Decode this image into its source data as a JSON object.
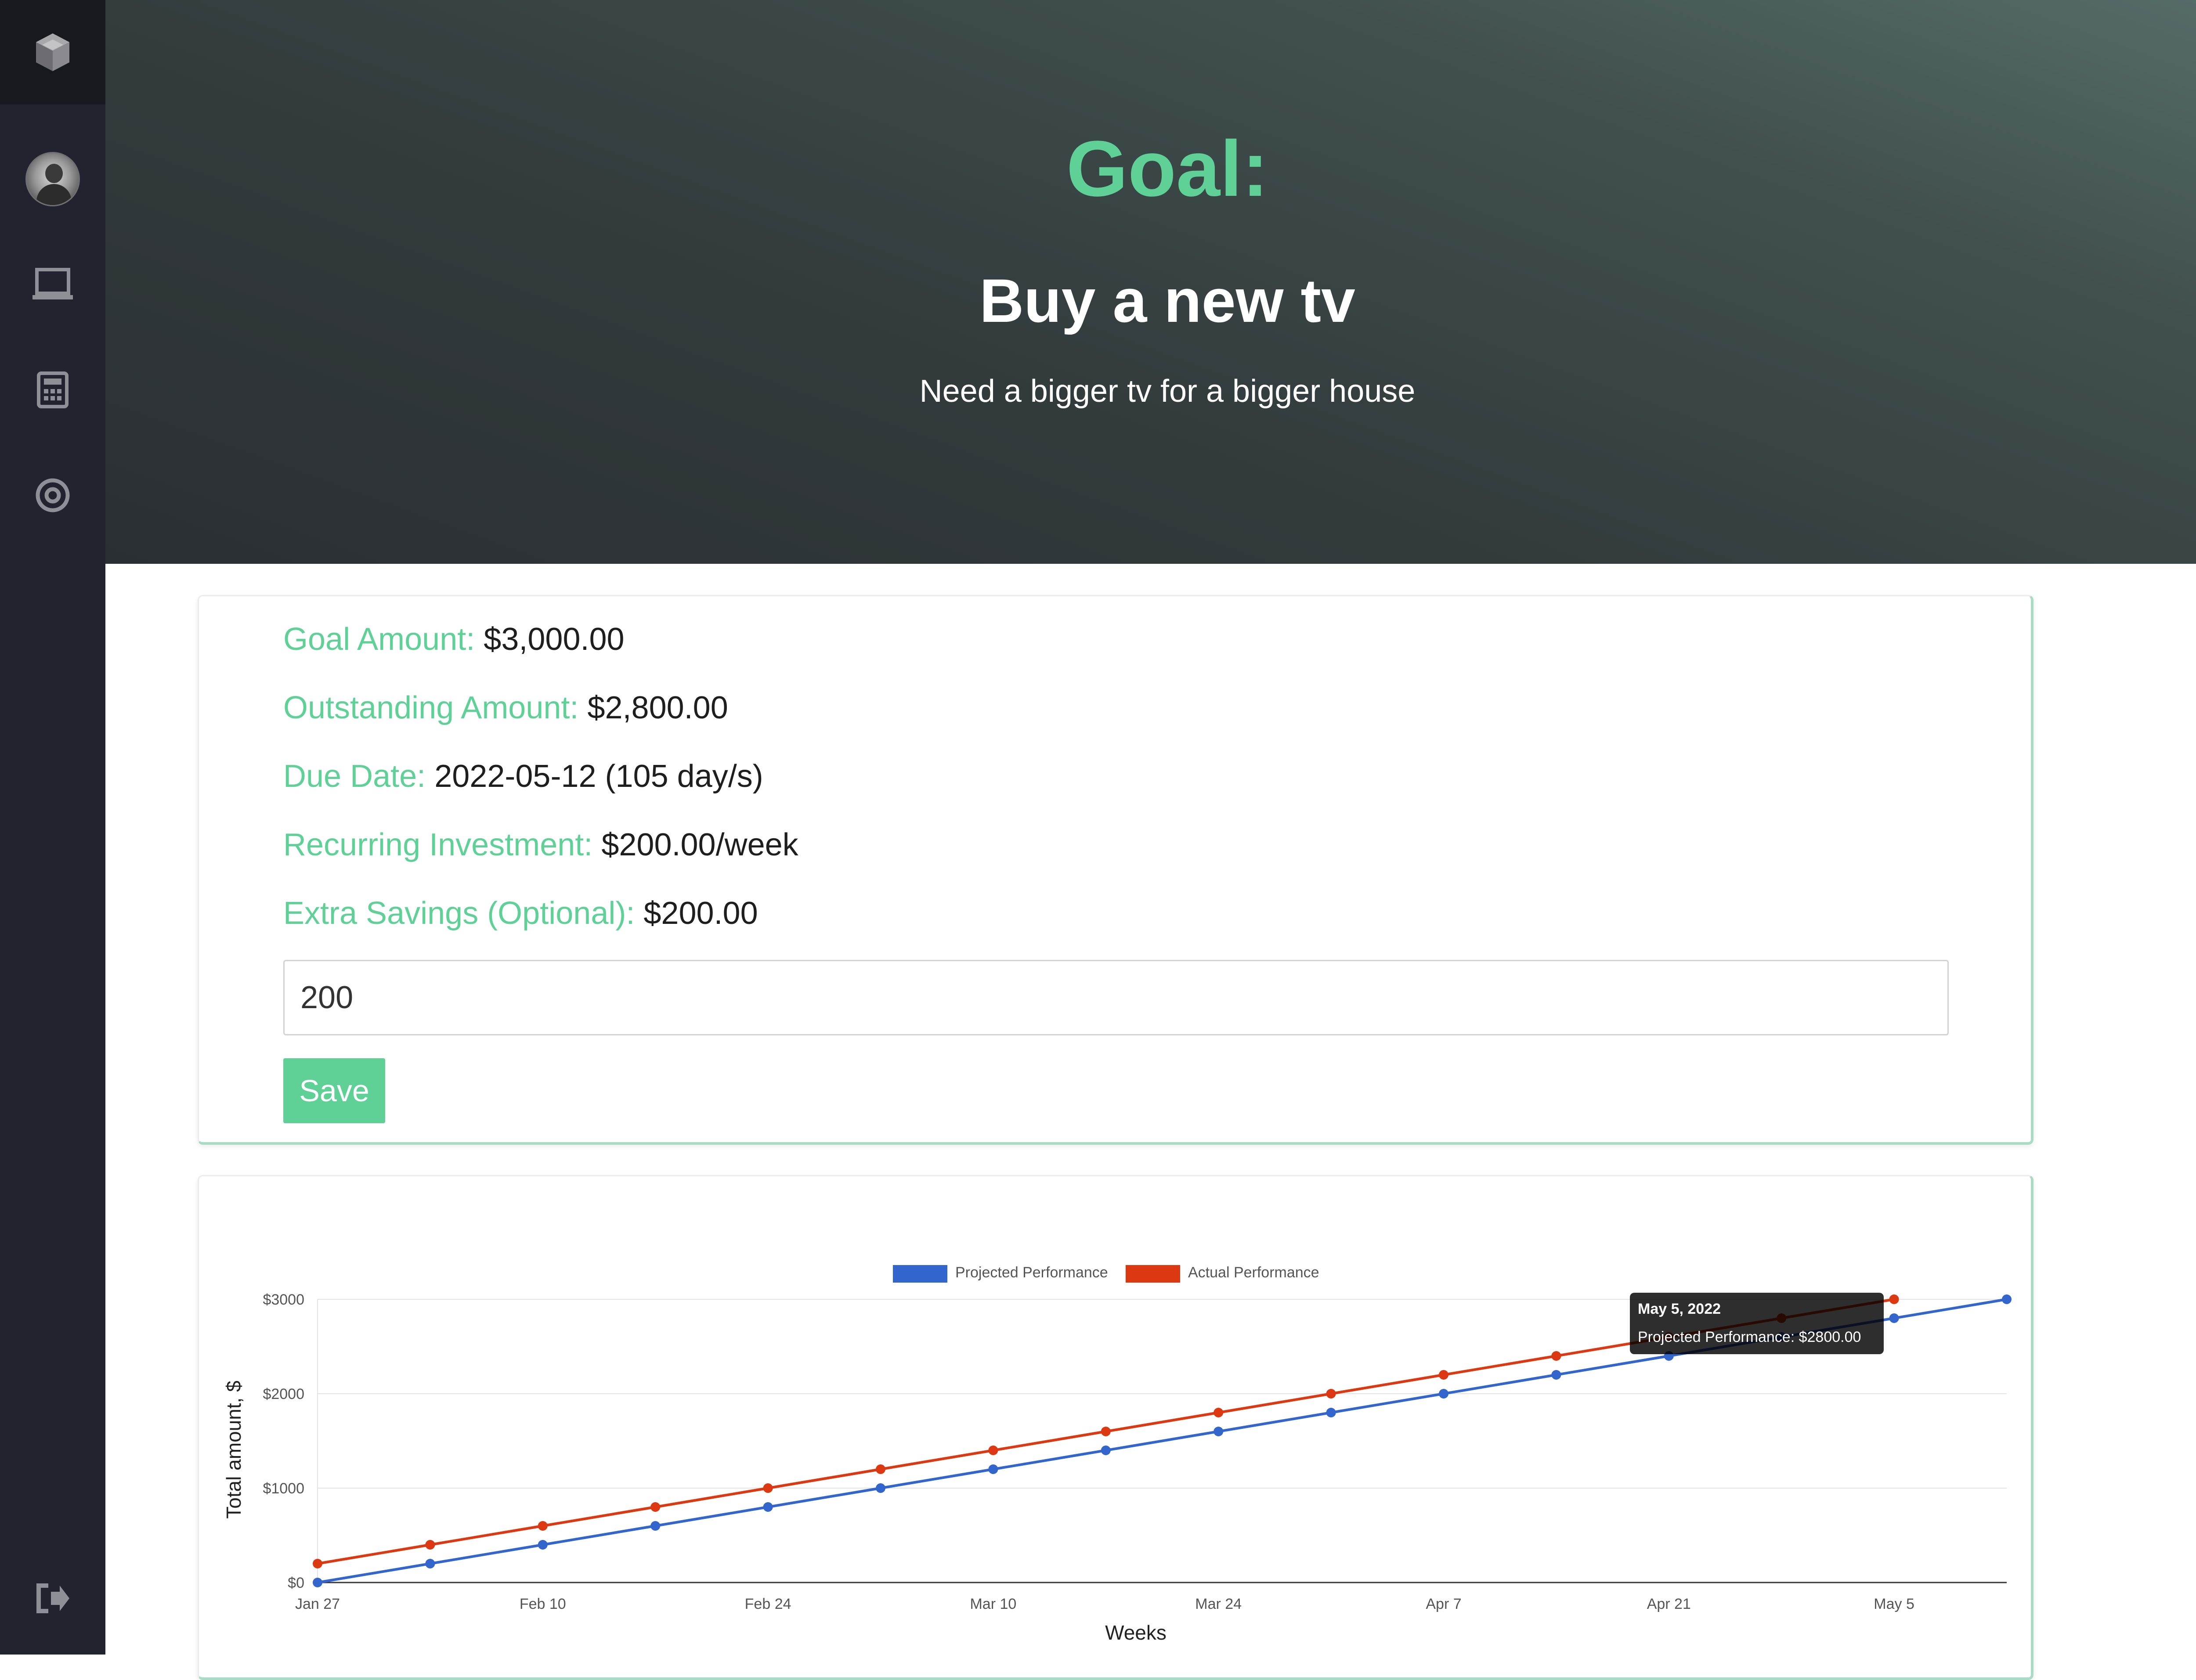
{
  "sidebar": {
    "items": [
      {
        "name": "logo",
        "icon": "cube-logo-icon"
      },
      {
        "name": "profile",
        "icon": "avatar"
      },
      {
        "name": "dashboard",
        "icon": "laptop-icon"
      },
      {
        "name": "calculator",
        "icon": "calculator-icon"
      },
      {
        "name": "goals",
        "icon": "target-icon"
      },
      {
        "name": "logout",
        "icon": "logout-icon"
      }
    ]
  },
  "hero": {
    "label": "Goal:",
    "title": "Buy a new tv",
    "description": "Need a bigger tv for a bigger house"
  },
  "details": {
    "goal_amount_label": "Goal Amount:",
    "goal_amount_value": "$3,000.00",
    "outstanding_label": "Outstanding Amount:",
    "outstanding_value": "$2,800.00",
    "due_date_label": "Due Date:",
    "due_date_value": "2022-05-12 (105 day/s)",
    "recurring_label": "Recurring Investment:",
    "recurring_value": "$200.00/week",
    "extra_label": "Extra Savings (Optional):",
    "extra_value": "$200.00",
    "extra_input_value": "200",
    "save_label": "Save"
  },
  "colors": {
    "accent": "#5fd196",
    "sidebar": "#22232f",
    "projected": "#3366cc",
    "actual": "#dc3912"
  },
  "tooltip": {
    "title": "May 5, 2022",
    "body": "Projected Performance: $2800.00"
  },
  "chart_data": {
    "type": "line",
    "xlabel": "Weeks",
    "ylabel": "Total amount, $",
    "legend_position": "top",
    "grid": true,
    "x": [
      "2022-01-27",
      "2022-02-03",
      "2022-02-10",
      "2022-02-17",
      "2022-02-24",
      "2022-03-03",
      "2022-03-10",
      "2022-03-17",
      "2022-03-24",
      "2022-03-31",
      "2022-04-07",
      "2022-04-14",
      "2022-04-21",
      "2022-04-28",
      "2022-05-05",
      "2022-05-12"
    ],
    "x_tick_labels": [
      "Jan 27",
      "Feb 10",
      "Feb 24",
      "Mar 10",
      "Mar 24",
      "Apr 7",
      "Apr 21",
      "May 5"
    ],
    "y_tick_labels": [
      "$0",
      "$1000",
      "$2000",
      "$3000"
    ],
    "ylim": [
      0,
      3000
    ],
    "series": [
      {
        "name": "Projected Performance",
        "color": "#3366cc",
        "values": [
          0,
          200,
          400,
          600,
          800,
          1000,
          1200,
          1400,
          1600,
          1800,
          2000,
          2200,
          2400,
          2600,
          2800,
          3000
        ]
      },
      {
        "name": "Actual Performance",
        "color": "#dc3912",
        "values": [
          200,
          400,
          600,
          800,
          1000,
          1200,
          1400,
          1600,
          1800,
          2000,
          2200,
          2400,
          2600,
          2800,
          3000
        ]
      }
    ]
  }
}
